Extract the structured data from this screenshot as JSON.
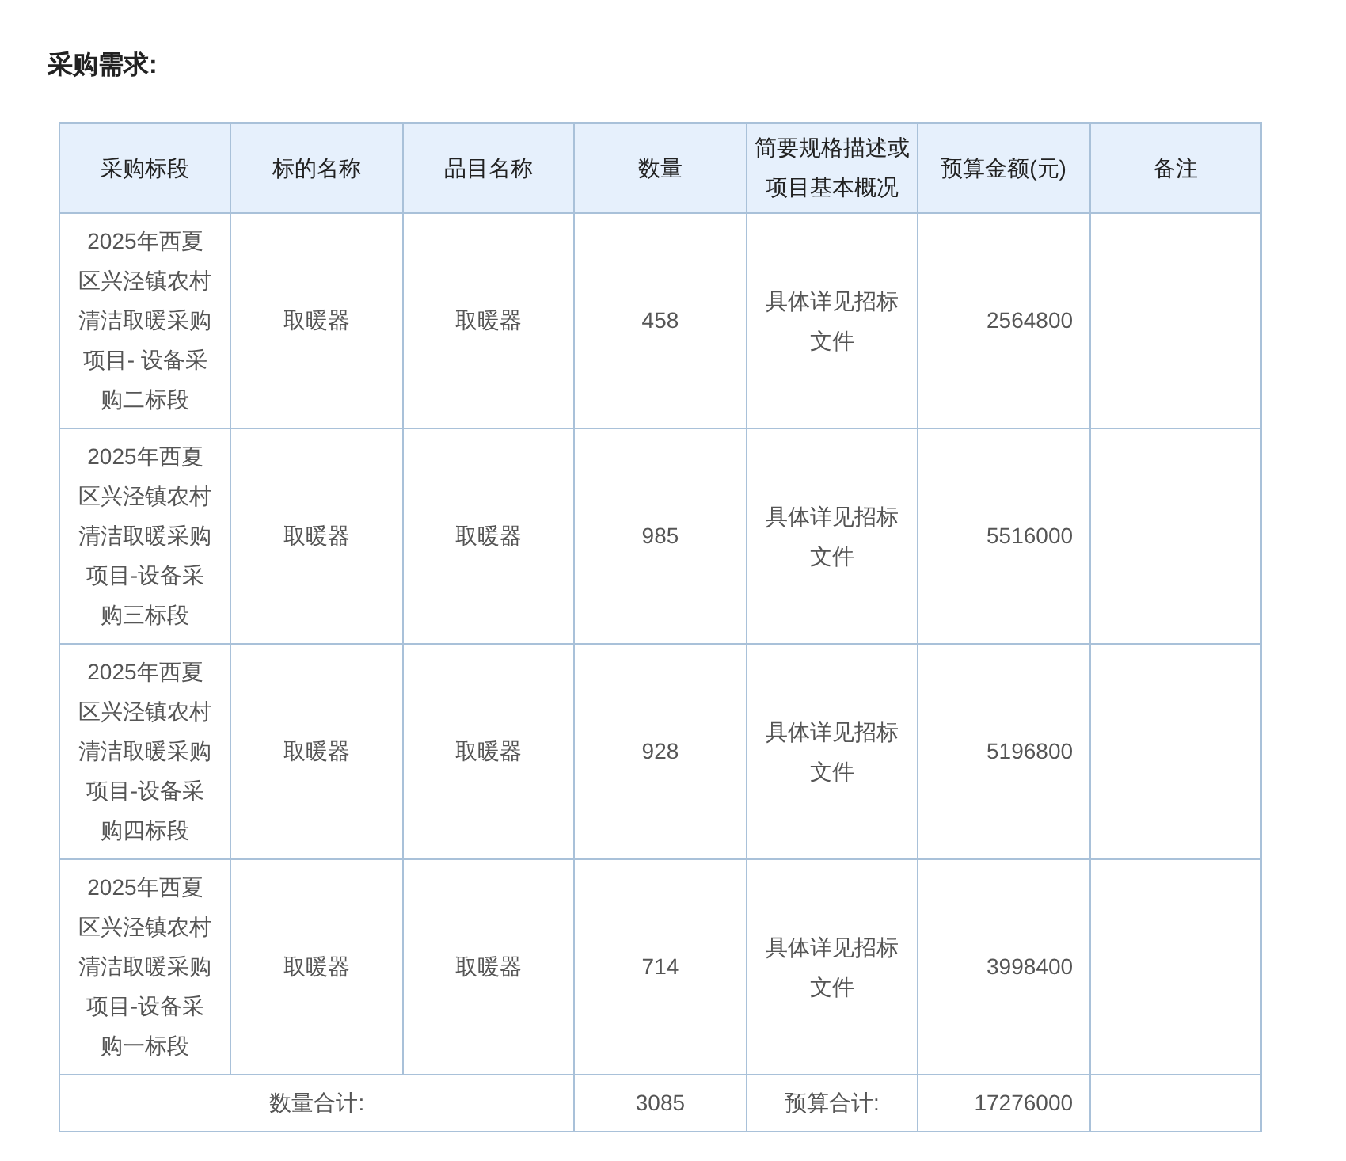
{
  "title": "采购需求:",
  "table": {
    "columns": [
      "采购标段",
      "标的名称",
      "品目名称",
      "数量",
      "简要规格描述或项目基本概况",
      "预算金额(元)",
      "备注"
    ],
    "rows": [
      {
        "segment": "2025年西夏区兴泾镇农村清洁取暖采购项目- 设备采购二标段",
        "subject": "取暖器",
        "item": "取暖器",
        "quantity": "458",
        "spec": "具体详见招标文件",
        "budget": "2564800"
      },
      {
        "segment": "2025年西夏区兴泾镇农村清洁取暖采购项目-设备采购三标段",
        "subject": "取暖器",
        "item": "取暖器",
        "quantity": "985",
        "spec": "具体详见招标文件",
        "budget": "5516000"
      },
      {
        "segment": "2025年西夏区兴泾镇农村清洁取暖采购项目-设备采购四标段",
        "subject": "取暖器",
        "item": "取暖器",
        "quantity": "928",
        "spec": "具体详见招标文件",
        "budget": "5196800"
      },
      {
        "segment": "2025年西夏区兴泾镇农村清洁取暖采购项目-设备采购一标段",
        "subject": "取暖器",
        "item": "取暖器",
        "quantity": "714",
        "spec": "具体详见招标文件",
        "budget": "3998400"
      }
    ],
    "footer": {
      "quantity_label": "数量合计:",
      "quantity_total": "3085",
      "budget_label": "预算合计:",
      "budget_total": "17276000"
    }
  }
}
